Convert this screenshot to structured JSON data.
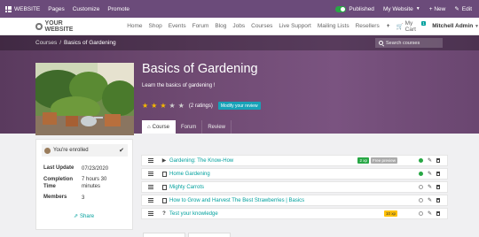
{
  "admin_bar": {
    "website": "WEBSITE",
    "items": [
      "Pages",
      "Customize",
      "Promote"
    ],
    "status": "Published",
    "my_website": "My Website",
    "new": "+ New",
    "edit": "Edit"
  },
  "nav": {
    "logo": "YOUR WEBSITE",
    "menu": [
      "Home",
      "Shop",
      "Events",
      "Forum",
      "Blog",
      "Jobs",
      "Courses",
      "Live Support",
      "Mailing Lists",
      "Resellers"
    ],
    "plus": "+",
    "cart": "My Cart",
    "cart_count": "1",
    "user": "Mitchell Admin"
  },
  "breadcrumb": {
    "root": "Courses",
    "sep": "/",
    "current": "Basics of Gardening"
  },
  "search": {
    "placeholder": "Search courses"
  },
  "course": {
    "title": "Basics of Gardening",
    "subtitle": "Learn the basics of gardening !",
    "rating_value": 3,
    "rating_max": 5,
    "ratings_text": "(2 ratings)",
    "review_button": "Modify your review"
  },
  "tabs": [
    {
      "label": "Course",
      "active": true
    },
    {
      "label": "Forum",
      "active": false
    },
    {
      "label": "Review",
      "active": false
    }
  ],
  "sidebar": {
    "enrolled": "You're enrolled",
    "last_update_label": "Last Update",
    "last_update_value": "07/23/2020",
    "completion_label": "Completion Time",
    "completion_value": "7 hours 30 minutes",
    "members_label": "Members",
    "members_value": "3",
    "share": "Share"
  },
  "lessons": [
    {
      "title": "Gardening: The Know-How",
      "type": "video",
      "points": "2 xp",
      "preview": "Free preview",
      "done": true
    },
    {
      "title": "Home Gardening",
      "type": "document",
      "done": true
    },
    {
      "title": "Mighty Carrots",
      "type": "document",
      "done": false
    },
    {
      "title": "How to Grow and Harvest The Best Strawberries | Basics",
      "type": "document",
      "done": false
    },
    {
      "title": "Test your knowledge",
      "type": "quiz",
      "points": "10 xp",
      "done": false
    }
  ],
  "colors": {
    "admin_bar": "#6b4b7a",
    "accent": "#00a09d",
    "hero": "#6f4a72",
    "star": "#f5b800"
  }
}
